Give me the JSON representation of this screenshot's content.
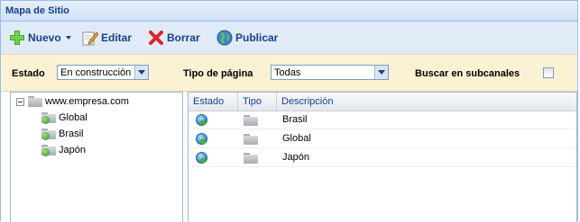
{
  "title": "Mapa de Sitio",
  "toolbar": {
    "nuevo": "Nuevo",
    "editar": "Editar",
    "borrar": "Borrar",
    "publicar": "Publicar"
  },
  "filters": {
    "estado_label": "Estado",
    "estado_value": "En construcción",
    "tipo_label": "Tipo de página",
    "tipo_value": "Todas",
    "buscar_label": "Buscar en subcanales",
    "buscar_checked": false
  },
  "tree": {
    "root": "www.empresa.com",
    "children": [
      "Global",
      "Brasil",
      "Japón"
    ]
  },
  "grid": {
    "columns": [
      "Estado",
      "Tipo",
      "Descripción"
    ],
    "rows": [
      {
        "estado": "published-globe-icon",
        "tipo": "folder-icon",
        "descripcion": "Brasil"
      },
      {
        "estado": "published-globe-icon",
        "tipo": "folder-icon",
        "descripcion": "Global"
      },
      {
        "estado": "published-globe-icon",
        "tipo": "folder-icon",
        "descripcion": "Japón"
      }
    ]
  },
  "colors": {
    "title_text": "#15428b",
    "toolbar_bg": "#e1ebf7",
    "filter_bg": "#fbf2d4",
    "border": "#99bbe8"
  }
}
